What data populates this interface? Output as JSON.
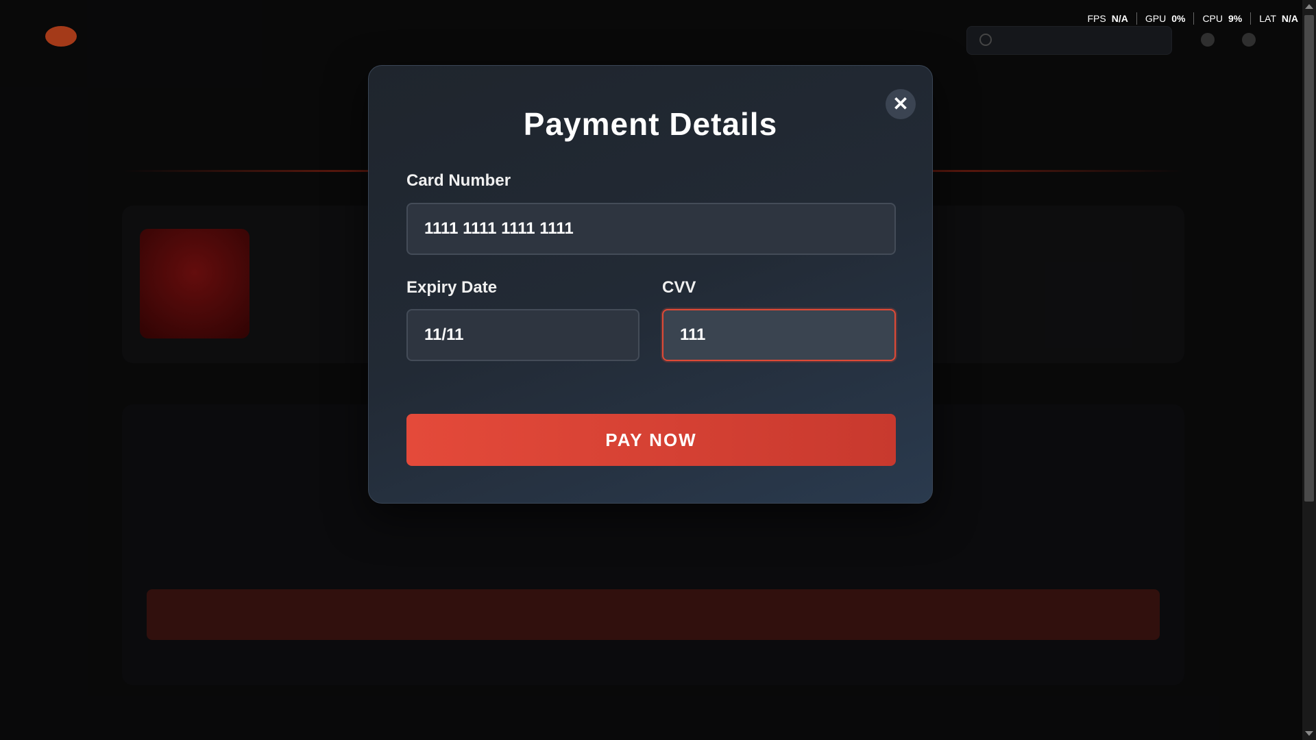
{
  "stats": [
    {
      "label": "FPS",
      "value": "N/A"
    },
    {
      "label": "GPU",
      "value": "0%"
    },
    {
      "label": "CPU",
      "value": "9%"
    },
    {
      "label": "LAT",
      "value": "N/A"
    }
  ],
  "modal": {
    "title": "Payment Details",
    "close_icon": "✕",
    "card_number_label": "Card Number",
    "card_number_value": "1111 1111 1111 1111",
    "expiry_label": "Expiry Date",
    "expiry_value": "11/11",
    "cvv_label": "CVV",
    "cvv_value": "111",
    "pay_button": "PAY NOW"
  },
  "colors": {
    "accent": "#e44a3a",
    "modal_bg": "#222a35",
    "focus_border": "#e04a36"
  }
}
